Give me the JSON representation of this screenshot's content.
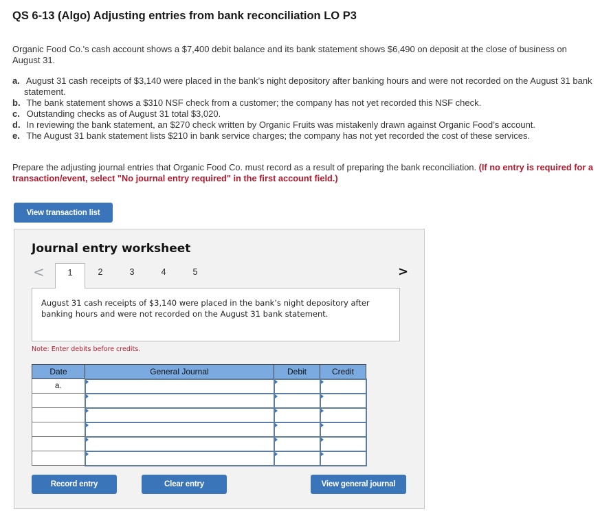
{
  "title": "QS 6-13 (Algo) Adjusting entries from bank reconciliation LO P3",
  "intro": "Organic Food Co.'s cash account shows a $7,400 debit balance and its bank statement shows $6,490 on deposit at the close of business on August 31.",
  "items": [
    {
      "label": "a.",
      "text": "August 31 cash receipts of $3,140 were placed in the bank’s night depository after banking hours and were not recorded on the August 31 bank statement."
    },
    {
      "label": "b.",
      "text": "The bank statement shows a $310 NSF check from a customer; the company has not yet recorded this NSF check."
    },
    {
      "label": "c.",
      "text": "Outstanding checks as of August 31 total $3,020."
    },
    {
      "label": "d.",
      "text": "In reviewing the bank statement, an $270 check written by Organic Fruits was mistakenly drawn against Organic Food’s account."
    },
    {
      "label": "e.",
      "text": "The August 31 bank statement lists $210 in bank service charges; the company has not yet recorded the cost of these services."
    }
  ],
  "prompt": {
    "text": "Prepare the adjusting journal entries that Organic Food Co. must record as a result of preparing the bank reconciliation. ",
    "warning": "(If no entry is required for a transaction/event, select \"No journal entry required\" in the first account field.)"
  },
  "buttons": {
    "view_transaction_list": "View transaction list",
    "record_entry": "Record entry",
    "clear_entry": "Clear entry",
    "view_general_journal": "View general journal"
  },
  "worksheet": {
    "title": "Journal entry worksheet",
    "prev": "<",
    "next": ">",
    "tabs": [
      "1",
      "2",
      "3",
      "4",
      "5"
    ],
    "active_tab": "1",
    "description": "August 31 cash receipts of $3,140 were placed in the bank’s night depository after banking hours and were not recorded on the August 31 bank statement.",
    "note": "Note: Enter debits before credits.",
    "columns": [
      "Date",
      "General Journal",
      "Debit",
      "Credit"
    ],
    "rows": [
      {
        "date": "a.",
        "account": "",
        "debit": "",
        "credit": ""
      },
      {
        "date": "",
        "account": "",
        "debit": "",
        "credit": ""
      },
      {
        "date": "",
        "account": "",
        "debit": "",
        "credit": ""
      },
      {
        "date": "",
        "account": "",
        "debit": "",
        "credit": ""
      },
      {
        "date": "",
        "account": "",
        "debit": "",
        "credit": ""
      },
      {
        "date": "",
        "account": "",
        "debit": "",
        "credit": ""
      }
    ]
  }
}
